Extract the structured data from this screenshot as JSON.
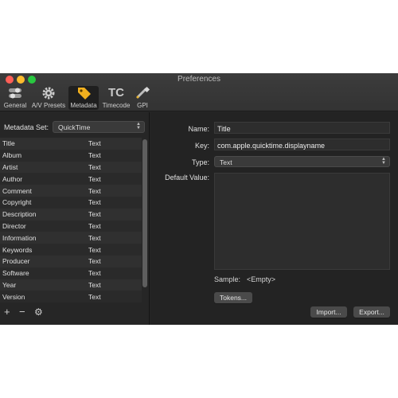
{
  "window": {
    "title": "Preferences"
  },
  "toolbar": {
    "items": [
      {
        "label": "General",
        "icon": "switch-icon"
      },
      {
        "label": "A/V Presets",
        "icon": "gear-icon"
      },
      {
        "label": "Metadata",
        "icon": "tag-icon"
      },
      {
        "label": "Timecode",
        "icon": "tc-icon",
        "glyph": "TC"
      },
      {
        "label": "GPI",
        "icon": "connector-icon"
      }
    ],
    "selected": "Metadata"
  },
  "left": {
    "metadata_set_label": "Metadata Set:",
    "metadata_set_value": "QuickTime",
    "rows": [
      {
        "name": "Title",
        "type": "Text"
      },
      {
        "name": "Album",
        "type": "Text"
      },
      {
        "name": "Artist",
        "type": "Text"
      },
      {
        "name": "Author",
        "type": "Text"
      },
      {
        "name": "Comment",
        "type": "Text"
      },
      {
        "name": "Copyright",
        "type": "Text"
      },
      {
        "name": "Description",
        "type": "Text"
      },
      {
        "name": "Director",
        "type": "Text"
      },
      {
        "name": "Information",
        "type": "Text"
      },
      {
        "name": "Keywords",
        "type": "Text"
      },
      {
        "name": "Producer",
        "type": "Text"
      },
      {
        "name": "Software",
        "type": "Text"
      },
      {
        "name": "Year",
        "type": "Text"
      },
      {
        "name": "Version",
        "type": "Text"
      }
    ],
    "add_glyph": "+",
    "remove_glyph": "−",
    "action_glyph": "⚙"
  },
  "right": {
    "name_label": "Name:",
    "name_value": "Title",
    "key_label": "Key:",
    "key_value": "com.apple.quicktime.displayname",
    "type_label": "Type:",
    "type_value": "Text",
    "default_label": "Default Value:",
    "sample_label": "Sample:",
    "sample_value": "<Empty>",
    "tokens_button": "Tokens...",
    "import_button": "Import...",
    "export_button": "Export..."
  },
  "colors": {
    "close": "#ff5f57",
    "minimize": "#febc2e",
    "zoom": "#28c840",
    "tag": "#f2b01e"
  }
}
